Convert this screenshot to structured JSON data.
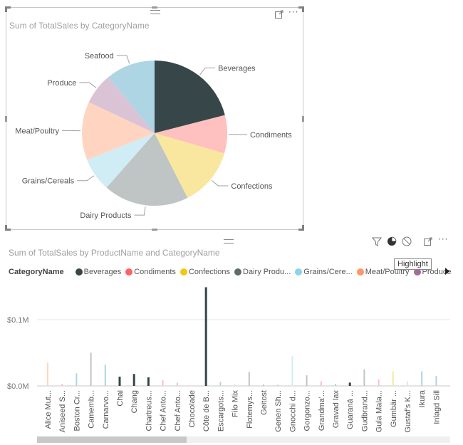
{
  "pie_visual": {
    "title": "Sum of TotalSales by CategoryName",
    "icons": {
      "focus": "focus-mode-icon",
      "more": "more-options-icon",
      "grip": "drag-grip-icon"
    },
    "more_label": "···"
  },
  "bar_visual": {
    "title": "Sum of TotalSales by ProductName and CategoryName",
    "icons": {
      "filter": "filter-icon",
      "highlight": "pie-highlight-icon",
      "none": "no-interaction-icon",
      "focus": "focus-mode-icon",
      "more": "more-options-icon"
    },
    "more_label": "···",
    "tooltip": "Highlight",
    "legend_title": "CategoryName",
    "legend": [
      {
        "label": "Beverages",
        "color": "#374649"
      },
      {
        "label": "Condiments",
        "color": "#FD625E"
      },
      {
        "label": "Confections",
        "color": "#F2C80F"
      },
      {
        "label": "Dairy Produ...",
        "color": "#5F6B6D"
      },
      {
        "label": "Grains/Cere...",
        "color": "#8AD4EB"
      },
      {
        "label": "Meat/Poultry",
        "color": "#FE9666"
      },
      {
        "label": "Produce",
        "color": "#A66999"
      }
    ]
  },
  "chart_data": [
    {
      "type": "pie",
      "title": "Sum of TotalSales by CategoryName",
      "categories": [
        "Beverages",
        "Condiments",
        "Confections",
        "Dairy Products",
        "Grains/Cereals",
        "Meat/Poultry",
        "Produce",
        "Seafood"
      ],
      "values": [
        21,
        8.5,
        13,
        19,
        7.5,
        13,
        7,
        11
      ],
      "unit": "percent of total (estimated)",
      "colors": [
        "#374649",
        "#FFC0C0",
        "#F9E79F",
        "#BFC4C5",
        "#D0ECF5",
        "#FFD5C2",
        "#DBC3D6",
        "#ADD5E3"
      ],
      "highlighted": "Beverages"
    },
    {
      "type": "bar",
      "title": "Sum of TotalSales by ProductName and CategoryName",
      "xlabel": "",
      "ylabel": "",
      "yticks": [
        "$0.0M",
        "$0.1M"
      ],
      "ylim": [
        0,
        0.15
      ],
      "grid": true,
      "legend_placement": "top-left",
      "highlighted_series": "Beverages",
      "categories": [
        "Alice Mut...",
        "Aniseed S...",
        "Boston Cr...",
        "Camemb...",
        "Carnarvo...",
        "Chai",
        "Chang",
        "Chartreus...",
        "Chef Anto...",
        "Chef Anto...",
        "Chocolade",
        "Côte de B...",
        "Escargots...",
        "Filo Mix",
        "Flotemys...",
        "Geitost",
        "Genen Sh...",
        "Gnocchi d...",
        "Gorgonzo...",
        "Grandma'...",
        "Gravad lax",
        "Guaraná ...",
        "Gudbrand...",
        "Gula Mala...",
        "Gumbär ...",
        "Gustaf's K...",
        "Ikura",
        "Inlagd Sill"
      ],
      "series_of_category": [
        "Meat/Poultry",
        "Condiments",
        "Seafood",
        "Dairy Products",
        "Seafood",
        "Beverages",
        "Beverages",
        "Beverages",
        "Condiments",
        "Condiments",
        "Confections",
        "Beverages",
        "Seafood",
        "Grains/Cereals",
        "Dairy Products",
        "Dairy Products",
        "Condiments",
        "Grains/Cereals",
        "Dairy Products",
        "Condiments",
        "Seafood",
        "Beverages",
        "Dairy Products",
        "Condiments",
        "Confections",
        "Grains/Cereals",
        "Seafood",
        "Seafood"
      ],
      "values": [
        0.035,
        0.003,
        0.019,
        0.05,
        0.032,
        0.014,
        0.018,
        0.013,
        0.009,
        0.005,
        0.001,
        0.149,
        0.006,
        0.003,
        0.021,
        0.002,
        0.002,
        0.045,
        0.016,
        0.007,
        0.003,
        0.005,
        0.025,
        0.01,
        0.022,
        0.007,
        0.022,
        0.015
      ],
      "unit": "$M",
      "bar_colors": {
        "Beverages": "#374649",
        "Condiments": "#FFC0C0",
        "Confections": "#F9E79F",
        "Dairy Products": "#BFC4C5",
        "Grains/Cereals": "#D0ECF5",
        "Meat/Poultry": "#FFD5C2",
        "Produce": "#DBC3D6",
        "Seafood": "#ADD5E3"
      }
    }
  ]
}
